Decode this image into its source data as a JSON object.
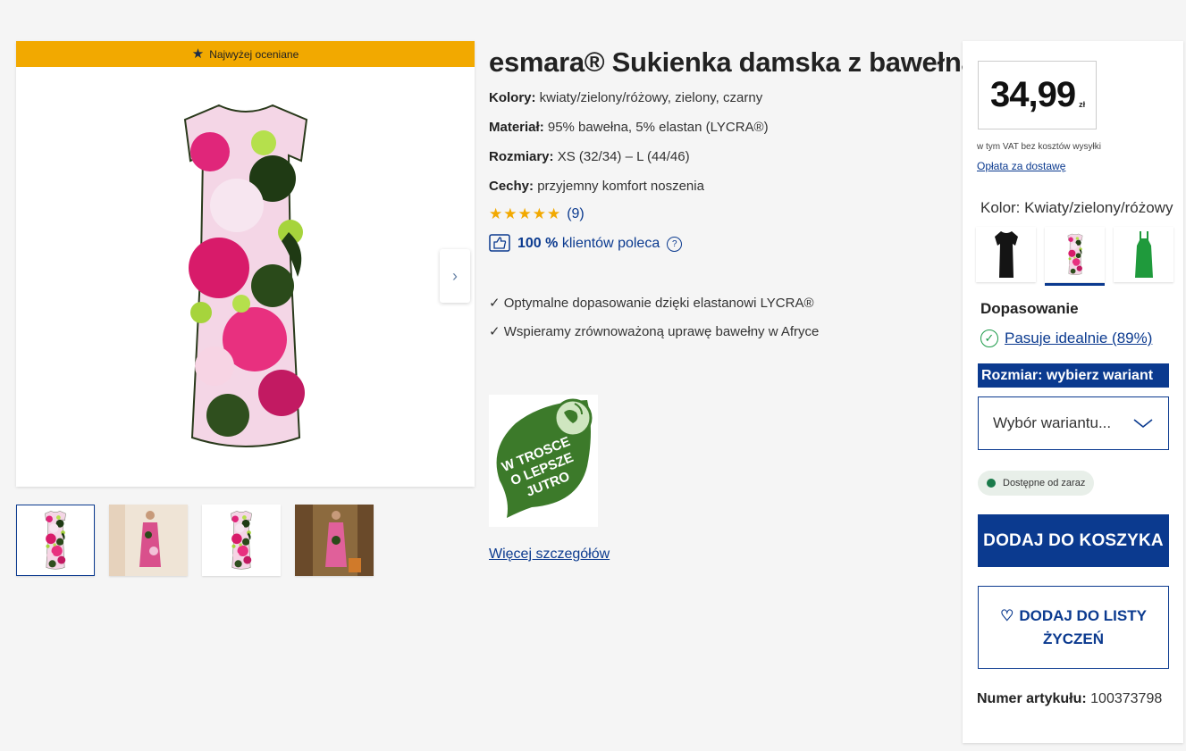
{
  "gallery": {
    "banner": "Najwyżej oceniane",
    "next_arrow": "›"
  },
  "product": {
    "title": "esmara® Sukienka damska z bawełną",
    "attributes": [
      {
        "label": "Kolory:",
        "value": "kwiaty/zielony/różowy, zielony, czarny"
      },
      {
        "label": "Materiał:",
        "value": "95% bawełna, 5% elastan (LYCRA®)"
      },
      {
        "label": "Rozmiary:",
        "value": "XS (32/34) – L (44/46)"
      },
      {
        "label": "Cechy:",
        "value": "przyjemny komfort noszenia"
      }
    ],
    "rating_stars": "★★★★★",
    "rating_count": "(9)",
    "recommend_percent": "100 %",
    "recommend_text": "klientów poleca",
    "features": [
      "✓ Optymalne dopasowanie dzięki elastanowi LYCRA®",
      "✓ Wspieramy zrównoważoną uprawę bawełny w Afryce"
    ],
    "badge_text": [
      "W TROSCE",
      "O LEPSZE",
      "JUTRO"
    ],
    "more_link": "Więcej szczegółów"
  },
  "buybox": {
    "price": "34,99",
    "currency": "zł",
    "vat_note": "w tym VAT bez kosztów wysyłki",
    "shipping_link": "Opłata za dostawę",
    "color_label": "Kolor:",
    "color_value": "Kwiaty/zielony/różowy",
    "fit_label": "Dopasowanie",
    "fit_value": "Pasuje idealnie (89%)",
    "size_label": "Rozmiar: wybierz wariant",
    "variant_placeholder": "Wybór wariantu...",
    "availability": "Dostępne od zaraz",
    "add_to_cart": "DODAJ DO KOSZYKA",
    "wishlist_line1": "DODAJ DO LISTY",
    "wishlist_line2": "ŻYCZEŃ",
    "article_label": "Numer artykułu:",
    "article_number": "100373798"
  },
  "colors": {
    "brand_blue": "#0b3a8f",
    "banner_orange": "#f2a900",
    "star_orange": "#f2a900",
    "available_green": "#1a7a4a"
  }
}
